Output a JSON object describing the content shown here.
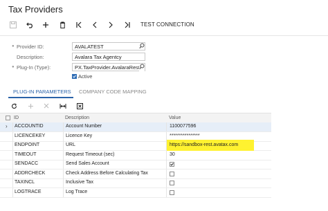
{
  "page": {
    "title": "Tax Providers"
  },
  "toolbar": {
    "test_connection_label": "TEST CONNECTION"
  },
  "form": {
    "provider_id": {
      "label": "Provider ID:",
      "value": "AVALATEST"
    },
    "description": {
      "label": "Description:",
      "value": "Avalara Tax Agentcy"
    },
    "plugin_type": {
      "label": "Plug-In (Type):",
      "value": "PX.TaxProvider.AvalaraRest.A"
    },
    "active": {
      "label": "Active",
      "checked": true
    }
  },
  "tabs": [
    {
      "label": "PLUG-IN PARAMETERS",
      "active": true
    },
    {
      "label": "COMPANY CODE MAPPING",
      "active": false
    }
  ],
  "grid": {
    "columns": [
      "ID",
      "Description",
      "Value"
    ],
    "rows": [
      {
        "id": "ACCOUNTID",
        "description": "Account Number",
        "value": "1100077596",
        "checkbox": null,
        "selected": true
      },
      {
        "id": "LICENCEKEY",
        "description": "Licence Key",
        "value": "****************",
        "checkbox": null
      },
      {
        "id": "ENDPOINT",
        "description": "URL",
        "value": "https://sandbox-rest.avatax.com",
        "checkbox": null,
        "highlight": true
      },
      {
        "id": "TIMEOUT",
        "description": "Request Timeout (sec)",
        "value": "30",
        "checkbox": null
      },
      {
        "id": "SENDACC",
        "description": "Send Sales Account",
        "value": "",
        "checkbox": true
      },
      {
        "id": "ADDRCHECK",
        "description": "Check Address Before Calculating Tax",
        "value": "",
        "checkbox": false
      },
      {
        "id": "TAXINCL",
        "description": "Inclusive Tax",
        "value": "",
        "checkbox": false
      },
      {
        "id": "LOGTRACE",
        "description": "Log Trace",
        "value": "",
        "checkbox": false
      }
    ]
  },
  "colors": {
    "accent": "#2a62a8",
    "highlight": "#fff230",
    "selected_row": "#e6eef8"
  }
}
